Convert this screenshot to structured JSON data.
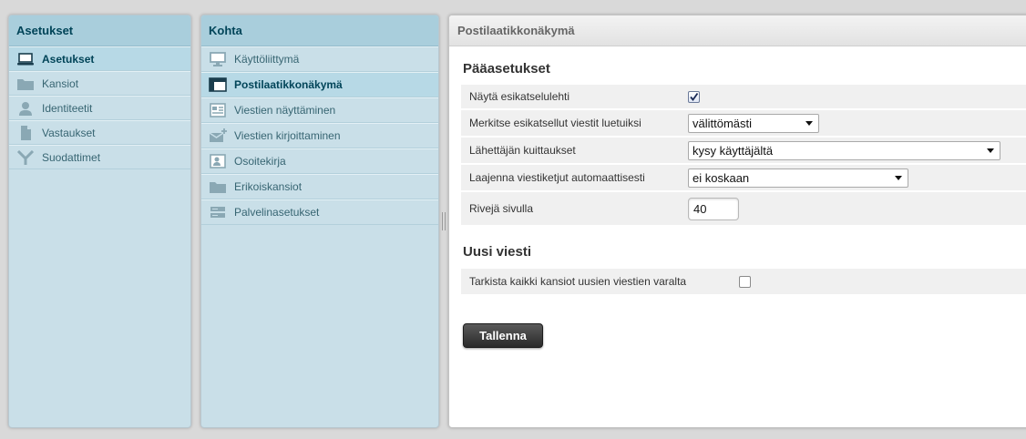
{
  "settings_panel": {
    "title": "Asetukset",
    "items": [
      {
        "label": "Asetukset",
        "icon": "laptop-icon",
        "selected": true
      },
      {
        "label": "Kansiot",
        "icon": "folder-icon",
        "selected": false
      },
      {
        "label": "Identiteetit",
        "icon": "person-icon",
        "selected": false
      },
      {
        "label": "Vastaukset",
        "icon": "document-icon",
        "selected": false
      },
      {
        "label": "Suodattimet",
        "icon": "filter-icon",
        "selected": false
      }
    ]
  },
  "section_panel": {
    "title": "Kohta",
    "items": [
      {
        "label": "Käyttöliittymä",
        "icon": "monitor-icon",
        "selected": false
      },
      {
        "label": "Postilaatikkonäkymä",
        "icon": "mailbox-layout-icon",
        "selected": true
      },
      {
        "label": "Viestien näyttäminen",
        "icon": "message-view-icon",
        "selected": false
      },
      {
        "label": "Viestien kirjoittaminen",
        "icon": "compose-icon",
        "selected": false
      },
      {
        "label": "Osoitekirja",
        "icon": "addressbook-icon",
        "selected": false
      },
      {
        "label": "Erikoiskansiot",
        "icon": "special-folder-icon",
        "selected": false
      },
      {
        "label": "Palvelinasetukset",
        "icon": "server-icon",
        "selected": false
      }
    ]
  },
  "prefs": {
    "title": "Postilaatikkonäkymä",
    "main_section": {
      "title": "Pääasetukset",
      "show_preview_label": "Näytä esikatselulehti",
      "show_preview_checked": true,
      "mark_read_label": "Merkitse esikatsellut viestit luetuiksi",
      "mark_read_value": "välittömästi",
      "receipts_label": "Lähettäjän kuittaukset",
      "receipts_value": "kysy käyttäjältä",
      "expand_threads_label": "Laajenna viestiketjut automaattisesti",
      "expand_threads_value": "ei koskaan",
      "rows_per_page_label": "Rivejä sivulla",
      "rows_per_page_value": "40"
    },
    "new_message_section": {
      "title": "Uusi viesti",
      "check_all_label": "Tarkista kaikki kansiot uusien viestien varalta",
      "check_all_checked": false
    },
    "save_label": "Tallenna"
  },
  "colors": {
    "panel_bg": "#c9dfe8",
    "header_bg": "#a9cedc",
    "selected_bg": "#b7d9e6",
    "text_dark_blue": "#004458",
    "item_text": "#376572",
    "button_bg": "#2a2a2a"
  }
}
